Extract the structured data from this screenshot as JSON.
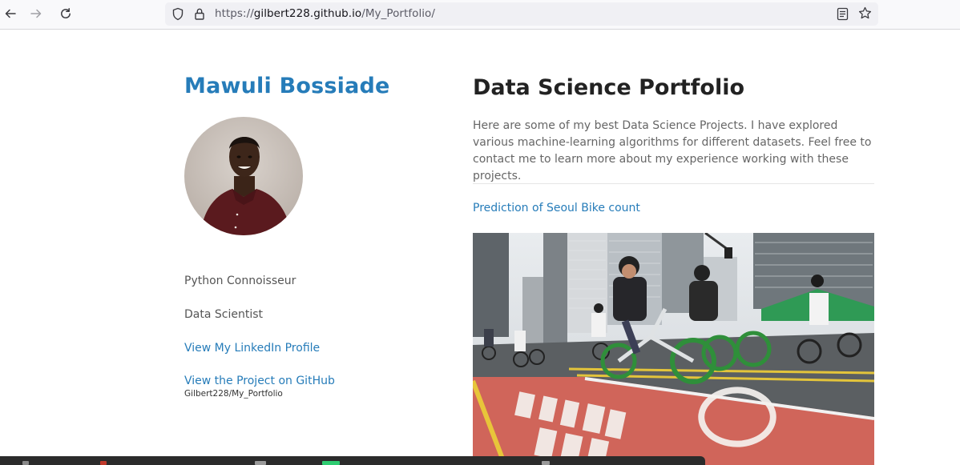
{
  "browser": {
    "url_prefix": "https://",
    "url_host": "gilbert228.github.io",
    "url_path": "/My_Portfolio/",
    "icons": [
      "back-arrow-icon",
      "forward-arrow-icon",
      "reload-icon",
      "shield-icon",
      "lock-icon",
      "reader-view-icon",
      "bookmark-star-icon"
    ]
  },
  "sidebar": {
    "name": "Mawuli Bossiade",
    "tagline_1": "Python Connoisseur",
    "tagline_2": "Data Scientist",
    "linkedin_label": "View My LinkedIn Profile",
    "github_label": "View the Project on GitHub",
    "github_repo": "Gilbert228/My_Portfolio"
  },
  "main": {
    "title": "Data Science Portfolio",
    "intro": "Here are some of my best Data Science Projects. I have explored various machine-learning algorithms for different datasets. Feel free to contact me to learn more about my experience working with these projects.",
    "projects": [
      {
        "label": "Prediction of Seoul Bike count"
      }
    ]
  },
  "colors": {
    "accent": "#267cb9",
    "heading": "#222222",
    "body_text": "#666666",
    "bike_lane": "#d0655a"
  }
}
